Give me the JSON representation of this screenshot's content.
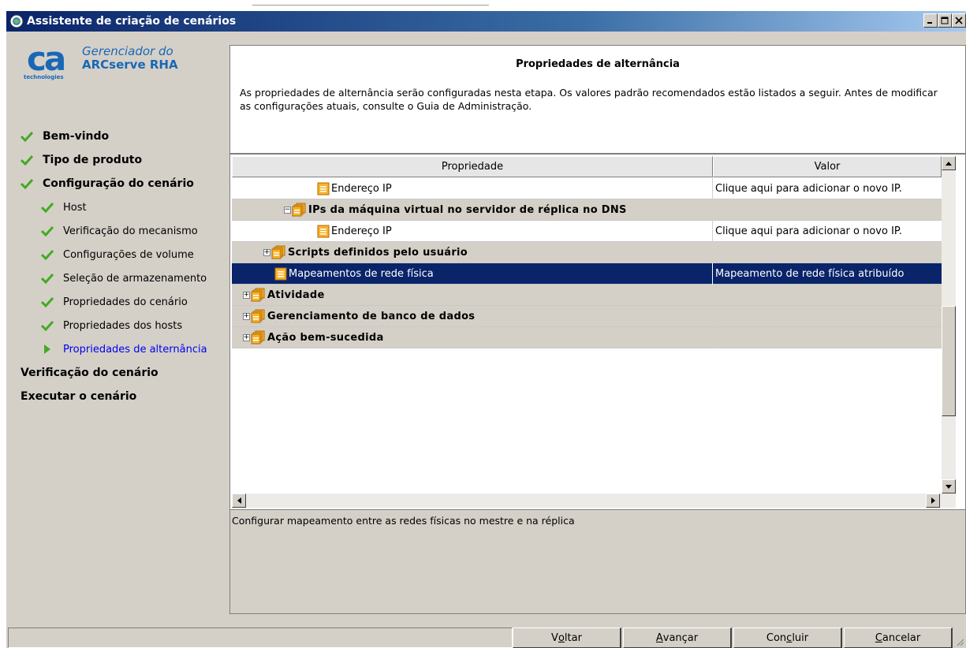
{
  "window": {
    "title": "Assistente de criação de cenários",
    "controls": [
      "minimize-icon",
      "maximize-icon",
      "close-icon"
    ]
  },
  "logo": {
    "mark": "ca",
    "tagline": "technologies",
    "line1": "Gerenciador do",
    "line2": "ARCserve RHA"
  },
  "nav": {
    "items": [
      {
        "label": "Bem-vindo",
        "level": 0,
        "state": "done"
      },
      {
        "label": "Tipo de produto",
        "level": 0,
        "state": "done"
      },
      {
        "label": "Configuração do cenário",
        "level": 0,
        "state": "done"
      },
      {
        "label": "Host",
        "level": 1,
        "state": "done"
      },
      {
        "label": "Verificação do mecanismo",
        "level": 1,
        "state": "done"
      },
      {
        "label": "Configurações de volume",
        "level": 1,
        "state": "done"
      },
      {
        "label": "Seleção de armazenamento",
        "level": 1,
        "state": "done"
      },
      {
        "label": "Propriedades do cenário",
        "level": 1,
        "state": "done"
      },
      {
        "label": "Propriedades dos hosts",
        "level": 1,
        "state": "done"
      },
      {
        "label": "Propriedades de alternância",
        "level": 1,
        "state": "current"
      },
      {
        "label": "Verificação do cenário",
        "level": 0,
        "state": "pending"
      },
      {
        "label": "Executar o cenário",
        "level": 0,
        "state": "pending"
      }
    ]
  },
  "header": {
    "title": "Propriedades de alternância",
    "description": "As propriedades de alternância serão configuradas nesta etapa. Os valores padrão recomendados estão listados a seguir. Antes de modificar as configurações atuais, consulte o Guia de Administração."
  },
  "grid": {
    "columns": {
      "property": "Propriedade",
      "value": "Valor"
    },
    "rows": [
      {
        "label": "Endereço IP",
        "value": "Clique aqui para adicionar o novo IP.",
        "type": "leaf",
        "indent": 4,
        "expander": ""
      },
      {
        "label": "IPs da máquina virtual no servidor de réplica no DNS",
        "value": "",
        "type": "group",
        "indent": 3,
        "expander": "-"
      },
      {
        "label": "Endereço IP",
        "value": "Clique aqui para adicionar o novo IP.",
        "type": "leaf",
        "indent": 4,
        "expander": ""
      },
      {
        "label": "Scripts definidos pelo usuário",
        "value": "",
        "type": "group",
        "indent": 2,
        "expander": "+"
      },
      {
        "label": "Mapeamentos de rede física",
        "value": "Mapeamento de rede física atribuído",
        "type": "leaf",
        "indent": 2,
        "expander": "",
        "selected": true
      },
      {
        "label": "Atividade",
        "value": "",
        "type": "group",
        "indent": 0,
        "expander": "+"
      },
      {
        "label": "Gerenciamento de banco de dados",
        "value": "",
        "type": "group",
        "indent": 0,
        "expander": "+"
      },
      {
        "label": "Ação bem-sucedida",
        "value": "",
        "type": "group",
        "indent": 0,
        "expander": "+"
      }
    ]
  },
  "description_panel": {
    "text": "Configurar mapeamento entre as redes físicas no mestre e na réplica"
  },
  "buttons": {
    "back": {
      "pre": "V",
      "key": "o",
      "post": "ltar"
    },
    "next": {
      "pre": "",
      "key": "A",
      "post": "vançar"
    },
    "finish": {
      "pre": "Con",
      "key": "c",
      "post": "luir"
    },
    "cancel": {
      "pre": "",
      "key": "C",
      "post": "ancelar"
    }
  },
  "colors": {
    "titlebar_start": "#0a246a",
    "selection": "#0a246a",
    "logo_blue": "#1a67b5",
    "check_green": "#44aa22",
    "active_nav": "#0000ee"
  }
}
